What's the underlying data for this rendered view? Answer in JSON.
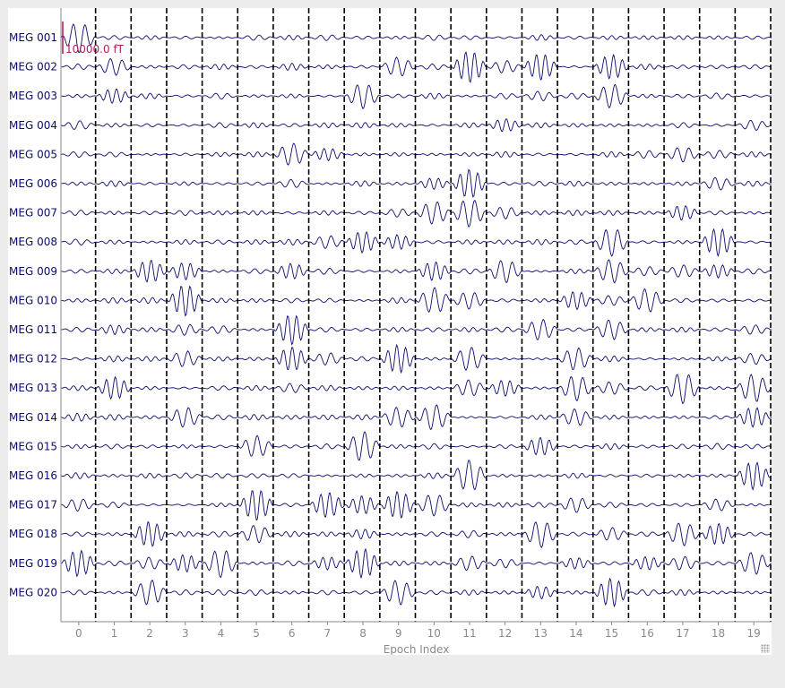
{
  "chart_data": {
    "type": "line",
    "title": "",
    "xlabel": "Epoch Index",
    "ylabel": "",
    "channels": [
      "MEG 001",
      "MEG 002",
      "MEG 003",
      "MEG 004",
      "MEG 005",
      "MEG 006",
      "MEG 007",
      "MEG 008",
      "MEG 009",
      "MEG 010",
      "MEG 011",
      "MEG 012",
      "MEG 013",
      "MEG 014",
      "MEG 015",
      "MEG 016",
      "MEG 017",
      "MEG 018",
      "MEG 019",
      "MEG 020"
    ],
    "epochs": [
      "0",
      "1",
      "2",
      "3",
      "4",
      "5",
      "6",
      "7",
      "8",
      "9",
      "10",
      "11",
      "12",
      "13",
      "14",
      "15",
      "16",
      "17",
      "18",
      "19"
    ],
    "scale_bar_label": "10000.0 fT",
    "trace_color": "#0b0b6e",
    "epoch_boundary_color": "#000000",
    "scale_bar_color": "#b0205a",
    "grid": false
  }
}
